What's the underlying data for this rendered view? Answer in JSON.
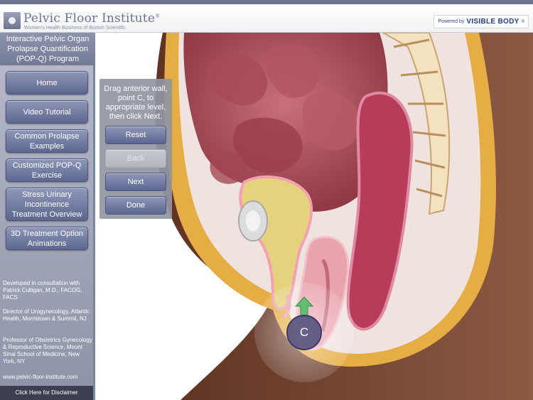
{
  "header": {
    "title": "Pelvic Floor Institute",
    "title_mark": "®",
    "subtitle": "Women's Health Business of Boston Scientific",
    "powered_prefix": "Powered by",
    "powered_brand": "VISIBLE BODY",
    "powered_mark": "®"
  },
  "sidebar": {
    "program_title": "Interactive Pelvic Organ Prolapse Quantification (POP-Q) Program",
    "nav": {
      "home": "Home",
      "video": "Video Tutorial",
      "examples": "Common Prolapse Examples",
      "exercise": "Customized POP-Q Exercise",
      "stress": "Stress Urinary Incontinence Treatment Overview",
      "animations": "3D Treatment Option Animations"
    },
    "credits": [
      "Developed in consultation with Patrick Culligan, M.D., FACOG, FACS",
      "Director of Urogynecology, Atlantic Health, Morristown & Summit, NJ",
      "Professor of Obstetrics Gynecology & Reproductive Science, Mount Sinai School of Medicine, New York, NY"
    ],
    "url": "www.pelvic-floor-institute.com",
    "disclaimer": "Click Here for Disclaimer"
  },
  "panel": {
    "instruction": "Drag anterior wall, point C, to appropriate level, then click Next.",
    "reset": "Reset",
    "back": "Back",
    "next": "Next",
    "done": "Done"
  },
  "illustration": {
    "handle_label": "C"
  },
  "colors": {
    "accent": "#6b7490",
    "button": "#6d76a0",
    "tissue": "#c24d63",
    "skin": "#7a4a38",
    "fat": "#e9b24a"
  }
}
